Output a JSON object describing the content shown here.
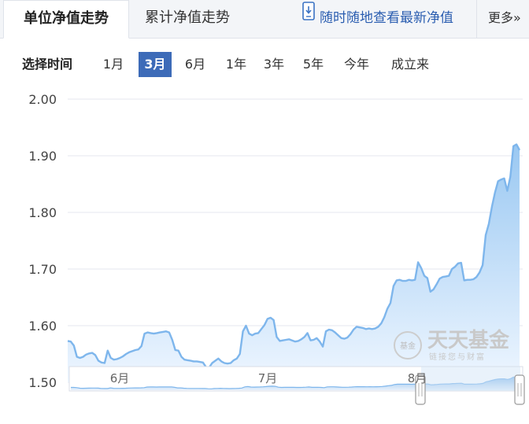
{
  "tabs": {
    "unit_nav_trend": "单位净值走势",
    "cumulative_nav_trend": "累计净值走势"
  },
  "phone_link": "随时随地查看最新净值",
  "more_link": "更多»",
  "time_range": {
    "label": "选择时间",
    "options": [
      "1月",
      "3月",
      "6月",
      "1年",
      "3年",
      "5年",
      "今年",
      "成立来"
    ],
    "selected": "3月"
  },
  "watermark": {
    "title": "天天基金",
    "subtitle": "链接您与财富",
    "badge": "基金"
  },
  "colors": {
    "line": "#7eb6ec",
    "area_top": "#9ac8f2",
    "area_bottom": "#eef6ff",
    "grid": "#e4e7ef",
    "selected_range": "#3d6bb8",
    "navigator_window": "#cfe2f7"
  },
  "chart_data": {
    "type": "area",
    "ylim": [
      1.5,
      2.0
    ],
    "yticks": [
      "1.50",
      "1.60",
      "1.70",
      "1.80",
      "1.90",
      "2.00"
    ],
    "grid": true,
    "x_labels": [
      "6月",
      "7月",
      "8月"
    ],
    "series": [
      {
        "values": [
          1.573,
          1.572,
          1.565,
          1.545,
          1.543,
          1.545,
          1.549,
          1.551,
          1.552,
          1.548,
          1.538,
          1.535,
          1.534,
          1.556,
          1.543,
          1.54,
          1.541,
          1.543,
          1.546,
          1.55,
          1.553,
          1.555,
          1.557,
          1.558,
          1.564,
          1.586,
          1.588,
          1.587,
          1.586,
          1.587,
          1.588,
          1.589,
          1.59,
          1.588,
          1.575,
          1.557,
          1.556,
          1.545,
          1.54,
          1.539,
          1.538,
          1.537,
          1.537,
          1.536,
          1.535,
          1.527,
          1.526,
          1.534,
          1.538,
          1.542,
          1.537,
          1.534,
          1.533,
          1.534,
          1.539,
          1.542,
          1.55,
          1.59,
          1.6,
          1.586,
          1.583,
          1.586,
          1.587,
          1.594,
          1.601,
          1.612,
          1.614,
          1.61,
          1.58,
          1.573,
          1.574,
          1.575,
          1.576,
          1.574,
          1.572,
          1.573,
          1.576,
          1.58,
          1.587,
          1.574,
          1.575,
          1.578,
          1.572,
          1.563,
          1.59,
          1.593,
          1.592,
          1.588,
          1.583,
          1.578,
          1.577,
          1.579,
          1.585,
          1.593,
          1.598,
          1.597,
          1.596,
          1.594,
          1.595,
          1.594,
          1.595,
          1.598,
          1.604,
          1.615,
          1.63,
          1.64,
          1.67,
          1.68,
          1.681,
          1.679,
          1.679,
          1.681,
          1.68,
          1.681,
          1.712,
          1.702,
          1.688,
          1.684,
          1.66,
          1.664,
          1.673,
          1.683,
          1.686,
          1.687,
          1.688,
          1.7,
          1.704,
          1.71,
          1.711,
          1.68,
          1.681,
          1.681,
          1.682,
          1.686,
          1.694,
          1.707,
          1.76,
          1.78,
          1.81,
          1.835,
          1.855,
          1.858,
          1.86,
          1.838,
          1.863,
          1.917,
          1.92,
          1.91
        ]
      }
    ]
  }
}
